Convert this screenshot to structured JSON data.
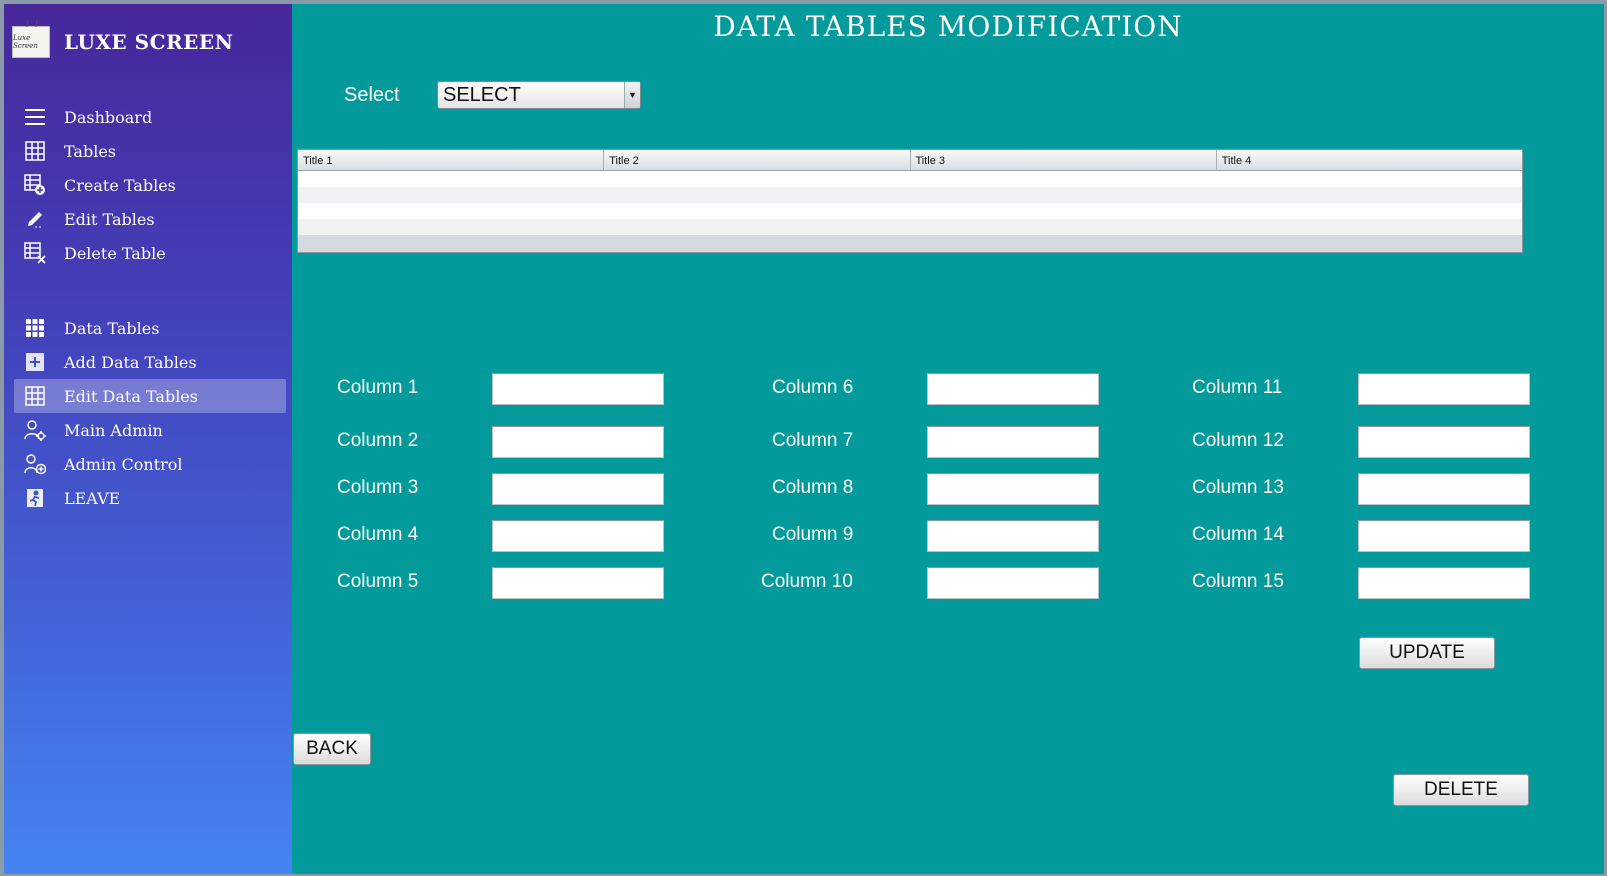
{
  "app": {
    "name": "LUXE SCREEN",
    "logo_text": "Luxe Screen"
  },
  "sidebar": {
    "group1": [
      {
        "label": "Dashboard",
        "icon": "menu-icon"
      },
      {
        "label": "Tables",
        "icon": "table-icon"
      },
      {
        "label": "Create Tables",
        "icon": "table-add-icon"
      },
      {
        "label": "Edit Tables",
        "icon": "pencil-icon"
      },
      {
        "label": "Delete Table",
        "icon": "table-delete-icon"
      }
    ],
    "group2": [
      {
        "label": "Data Tables",
        "icon": "grid-icon"
      },
      {
        "label": "Add Data Tables",
        "icon": "plus-box-icon"
      },
      {
        "label": "Edit Data Tables",
        "icon": "table-icon",
        "active": true
      },
      {
        "label": "Main Admin",
        "icon": "user-gear-icon"
      },
      {
        "label": "Admin Control",
        "icon": "user-add-icon"
      },
      {
        "label": "LEAVE",
        "icon": "exit-icon"
      }
    ]
  },
  "main": {
    "title": "DATA TABLES MODIFICATION",
    "select_label": "Select",
    "select_value": "SELECT",
    "table": {
      "columns": [
        "Title 1",
        "Title 2",
        "Title 3",
        "Title 4"
      ]
    },
    "fields": [
      {
        "label": "Column 1",
        "value": ""
      },
      {
        "label": "Column 2",
        "value": ""
      },
      {
        "label": "Column 3",
        "value": ""
      },
      {
        "label": "Column 4",
        "value": ""
      },
      {
        "label": "Column 5",
        "value": ""
      },
      {
        "label": "Column 6",
        "value": ""
      },
      {
        "label": "Column 7",
        "value": ""
      },
      {
        "label": "Column 8",
        "value": ""
      },
      {
        "label": "Column 9",
        "value": ""
      },
      {
        "label": "Column 10",
        "value": ""
      },
      {
        "label": "Column 11",
        "value": ""
      },
      {
        "label": "Column 12",
        "value": ""
      },
      {
        "label": "Column 13",
        "value": ""
      },
      {
        "label": "Column 14",
        "value": ""
      },
      {
        "label": "Column 15",
        "value": ""
      }
    ],
    "buttons": {
      "update": "UPDATE",
      "back": "BACK",
      "delete": "DELETE"
    }
  },
  "colors": {
    "content_bg": "#029a9a",
    "sidebar_top": "#47279b",
    "sidebar_bottom": "#4485f2"
  }
}
